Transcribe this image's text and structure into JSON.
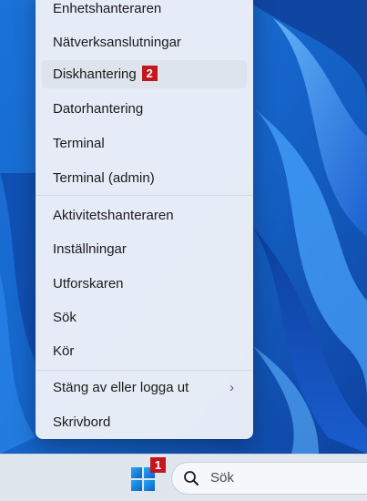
{
  "menu": {
    "items": [
      {
        "label": "Enhetshanteraren"
      },
      {
        "label": "Nätverksanslutningar"
      },
      {
        "label": "Diskhantering",
        "badge": "2"
      },
      {
        "label": "Datorhantering"
      },
      {
        "label": "Terminal"
      },
      {
        "label": "Terminal (admin)"
      },
      {
        "label": "Aktivitetshanteraren"
      },
      {
        "label": "Inställningar"
      },
      {
        "label": "Utforskaren"
      },
      {
        "label": "Sök"
      },
      {
        "label": "Kör"
      },
      {
        "label": "Stäng av eller logga ut",
        "chevron": "›"
      },
      {
        "label": "Skrivbord"
      }
    ]
  },
  "taskbar": {
    "start_badge": "1",
    "search_placeholder": "Sök"
  },
  "colors": {
    "badge": "#c4161c",
    "hover": "#dde4ee",
    "accent": "#0078d4"
  },
  "icons": {
    "start": "windows-logo-icon",
    "search": "search-icon",
    "submenu": "chevron-right-icon"
  }
}
